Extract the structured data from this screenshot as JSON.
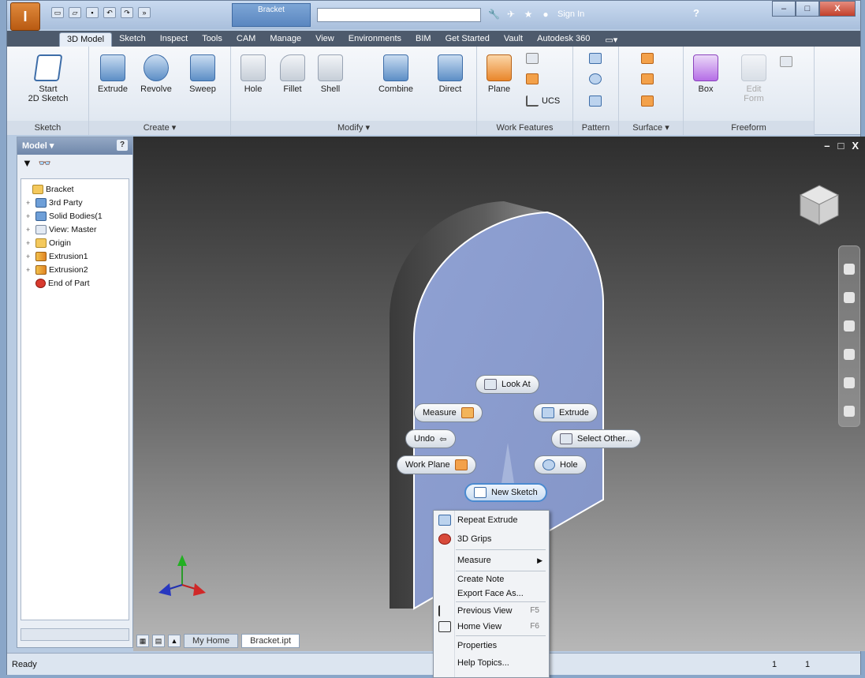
{
  "title_bar": {
    "app_button_glyph": "I",
    "document_title": "Bracket",
    "search_placeholder": "",
    "sign_in_label": "Sign In",
    "help_glyph": "?",
    "window_controls": [
      "–",
      "□",
      "X"
    ]
  },
  "tabs": [
    "3D Model",
    "Sketch",
    "Inspect",
    "Tools",
    "CAM",
    "Manage",
    "View",
    "Environments",
    "BIM",
    "Get Started",
    "Vault",
    "Autodesk 360"
  ],
  "active_tab": "3D Model",
  "ribbon": {
    "sketch_panel": {
      "title": "Sketch",
      "start_sketch": "Start\n2D Sketch"
    },
    "create_panel": {
      "title": "Create ▾",
      "buttons": [
        "Extrude",
        "Revolve",
        "Sweep"
      ]
    },
    "modify_panel": {
      "title": "Modify ▾",
      "buttons": [
        "Hole",
        "Fillet",
        "Shell",
        "Combine",
        "Direct"
      ]
    },
    "work_features_panel": {
      "title": "Work Features",
      "plane": "Plane",
      "ucs": "UCS"
    },
    "pattern_panel": {
      "title": "Pattern"
    },
    "surface_panel": {
      "title": "Surface ▾"
    },
    "freeform_panel": {
      "title": "Freeform",
      "box": "Box",
      "edit_form": "Edit\nForm"
    }
  },
  "browser": {
    "header": "Model ▾",
    "help_glyph": "?",
    "close_glyph": "×",
    "tree": [
      {
        "label": "Bracket",
        "icon": "folder",
        "indent": 0,
        "expander": ""
      },
      {
        "label": "3rd Party",
        "icon": "bluebox",
        "indent": 1,
        "expander": "+"
      },
      {
        "label": "Solid Bodies(1",
        "icon": "bluebox",
        "indent": 1,
        "expander": "+"
      },
      {
        "label": "View: Master",
        "icon": "view",
        "indent": 1,
        "expander": "+"
      },
      {
        "label": "Origin",
        "icon": "folder",
        "indent": 1,
        "expander": "+"
      },
      {
        "label": "Extrusion1",
        "icon": "ext",
        "indent": 1,
        "expander": "+"
      },
      {
        "label": "Extrusion2",
        "icon": "ext",
        "indent": 1,
        "expander": "+"
      },
      {
        "label": "End of Part",
        "icon": "end",
        "indent": 1,
        "expander": ""
      }
    ]
  },
  "marking_menu": {
    "look_at": "Look At",
    "measure": "Measure",
    "extrude": "Extrude",
    "undo": "Undo",
    "select_other": "Select Other...",
    "work_plane": "Work Plane",
    "hole": "Hole",
    "new_sketch": "New Sketch"
  },
  "context_menu": {
    "repeat_extrude": "Repeat Extrude",
    "grips_3d": "3D Grips",
    "measure": "Measure",
    "create_note": "Create Note",
    "export_face_as": "Export Face As...",
    "previous_view": "Previous View",
    "previous_view_shortcut": "F5",
    "home_view": "Home View",
    "home_view_shortcut": "F6",
    "properties": "Properties",
    "help_topics": "Help Topics..."
  },
  "doc_tabs": {
    "home": "My Home",
    "file": "Bracket.ipt"
  },
  "viewport_controls": [
    "–",
    "□",
    "X"
  ],
  "status": {
    "text": "Ready",
    "n1": "1",
    "n2": "1"
  },
  "colors": {
    "accent": "#4a8ad0",
    "face_color": "#8a9dd0",
    "tab_bar": "#4d5a6c"
  }
}
